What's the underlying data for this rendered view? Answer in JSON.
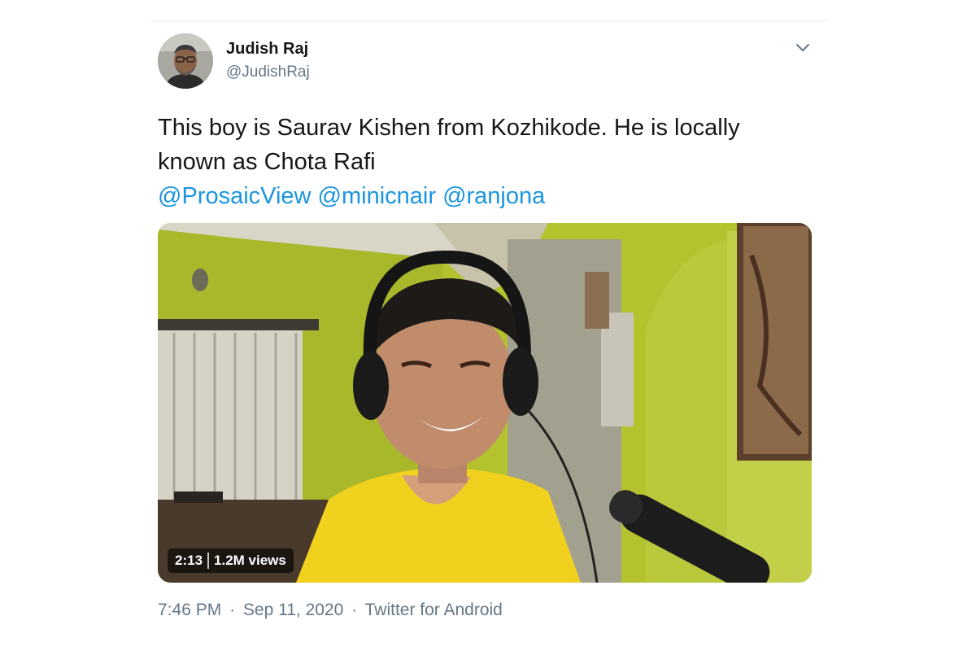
{
  "tweet": {
    "author": {
      "display_name": "Judish Raj",
      "handle": "@JudishRaj"
    },
    "text_line_1": "This boy is Saurav Kishen from Kozhikode. He is locally",
    "text_line_2": "known as Chota Rafi",
    "mentions": [
      "@ProsaicView",
      "@minicnair",
      "@ranjona"
    ],
    "media": {
      "duration": "2:13",
      "views": "1.2M views"
    },
    "timestamp": {
      "time": "7:46 PM",
      "separator": "·",
      "date": "Sep 11, 2020",
      "source": "Twitter for Android"
    },
    "menu_icon": "chevron-down-icon"
  },
  "colors": {
    "text": "#14171a",
    "secondary": "#657786",
    "link": "#1b95e0",
    "wall": "#b9c633",
    "shirt": "#f0d21e"
  }
}
